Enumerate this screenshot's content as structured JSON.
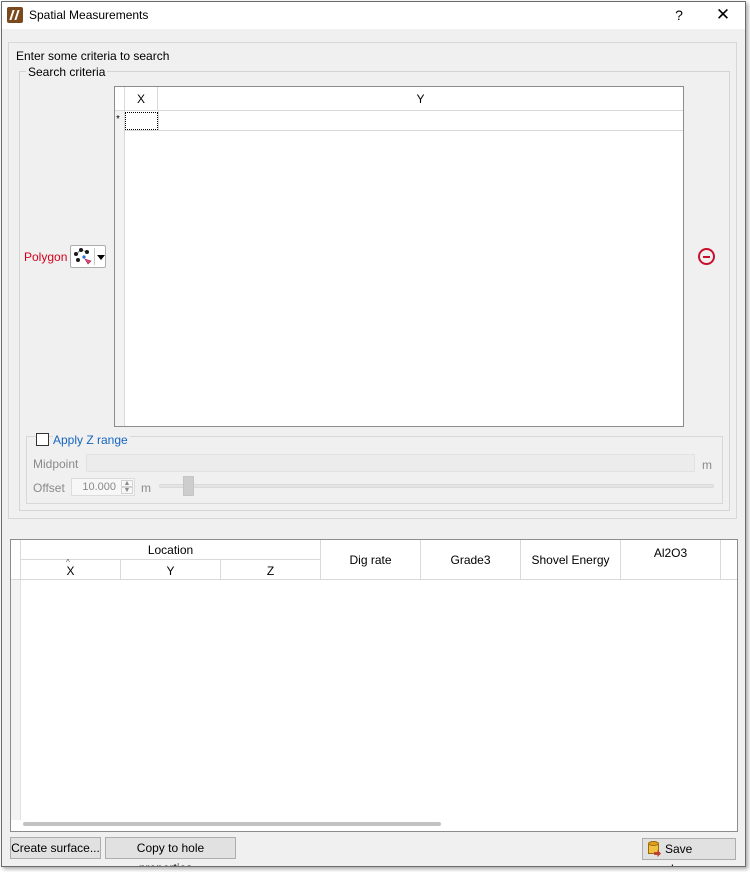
{
  "window": {
    "title": "Spatial Measurements",
    "help_label": "?",
    "close_label": "✕"
  },
  "criteria": {
    "prompt": "Enter some criteria to search",
    "group_label": "Search criteria",
    "polygon_label": "Polygon",
    "grid": {
      "columns": [
        "X",
        "Y"
      ],
      "new_row_marker": "*"
    }
  },
  "z_range": {
    "checkbox_label": "Apply Z range",
    "checked": false,
    "midpoint_label": "Midpoint",
    "midpoint_unit": "m",
    "offset_label": "Offset",
    "offset_value": "10.000",
    "offset_unit": "m"
  },
  "results": {
    "group_header": "Location",
    "location_columns": [
      "X",
      "Y",
      "Z"
    ],
    "columns": [
      "Dig rate",
      "Grade3",
      "Shovel Energy",
      "Al2O3"
    ]
  },
  "buttons": {
    "create_surface": "Create surface...",
    "copy_to_hole": "Copy to hole properties...",
    "save_changes": "Save changes"
  },
  "colors": {
    "polygon_label": "#d4001a",
    "z_range_label": "#1565c0",
    "remove_icon": "#c8102e"
  }
}
